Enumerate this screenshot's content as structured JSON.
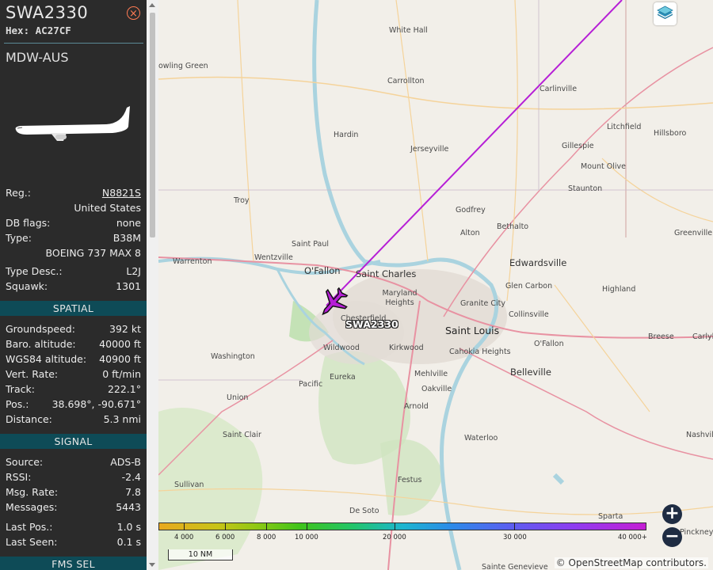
{
  "sidebar": {
    "callsign": "SWA2330",
    "hex_label": "Hex:",
    "hex_value": "AC27CF",
    "route": "MDW-AUS",
    "close_symbol": "×",
    "info": [
      {
        "label": "Reg.:",
        "value": "N8821S"
      },
      {
        "label": "",
        "value": "United States"
      },
      {
        "label": "DB flags:",
        "value": "none"
      },
      {
        "label": "Type:",
        "value": "B38M"
      },
      {
        "label": "",
        "value": "BOEING 737 MAX 8"
      },
      {
        "label": "Type Desc.:",
        "value": "L2J"
      },
      {
        "label": "Squawk:",
        "value": "1301"
      }
    ],
    "spatial_header": "SPATIAL",
    "spatial": [
      {
        "label": "Groundspeed:",
        "value": "392 kt"
      },
      {
        "label": "Baro. altitude:",
        "value": "40000 ft"
      },
      {
        "label": "WGS84 altitude:",
        "value": "40900 ft"
      },
      {
        "label": "Vert. Rate:",
        "value": "0 ft/min"
      },
      {
        "label": "Track:",
        "value": "222.1°"
      },
      {
        "label": "Pos.:",
        "value": "38.698°, -90.671°"
      },
      {
        "label": "Distance:",
        "value": "5.3 nmi"
      }
    ],
    "signal_header": "SIGNAL",
    "signal": [
      {
        "label": "Source:",
        "value": "ADS-B"
      },
      {
        "label": "RSSI:",
        "value": "-2.4"
      },
      {
        "label": "Msg. Rate:",
        "value": "7.8"
      },
      {
        "label": "Messages:",
        "value": "5443"
      },
      {
        "label": "Last Pos.:",
        "value": "1.0 s"
      },
      {
        "label": "Last Seen:",
        "value": "0.1 s"
      }
    ],
    "fms_header": "FMS SEL"
  },
  "map": {
    "aircraft_label": "SWA2330",
    "track_color": "#b61fd6",
    "towns": [
      "White Hall",
      "owling Green",
      "Carrollton",
      "Carlinville",
      "Litchfield",
      "Hillsboro",
      "Hardin",
      "Jerseyville",
      "Gillespie",
      "Mount Olive",
      "Staunton",
      "Troy",
      "Godfrey",
      "Bethalto",
      "Alton",
      "Greenville",
      "Saint Paul",
      "Wentzville",
      "Warrenton",
      "O'Fallon",
      "Saint Charles",
      "Edwardsville",
      "Maryland Heights",
      "Chesterfield",
      "Granite City",
      "Glen Carbon",
      "Highland",
      "Collinsville",
      "Saint Louis",
      "Cahokia Heights",
      "Kirkwood",
      "Wildwood",
      "Washington",
      "O'Fallon",
      "Breese",
      "Carlyl",
      "Belleville",
      "Eureka",
      "Pacific",
      "Mehlville",
      "Oakville",
      "Union",
      "Arnold",
      "Saint Clair",
      "Waterloo",
      "Nashvil",
      "Sullivan",
      "Festus",
      "De Soto",
      "Sparta",
      "Pinckney",
      "Sainte Genevieve"
    ],
    "scale_label": "10 NM",
    "attribution": "© OpenStreetMap contributors.",
    "altitude_legend": [
      "4 000",
      "6 000",
      "8 000",
      "10 000",
      "20 000",
      "30 000",
      "40 000+"
    ],
    "icons": [
      "layers-icon",
      "zoom-in-icon",
      "zoom-out-icon",
      "close-icon",
      "aircraft-icon"
    ]
  }
}
